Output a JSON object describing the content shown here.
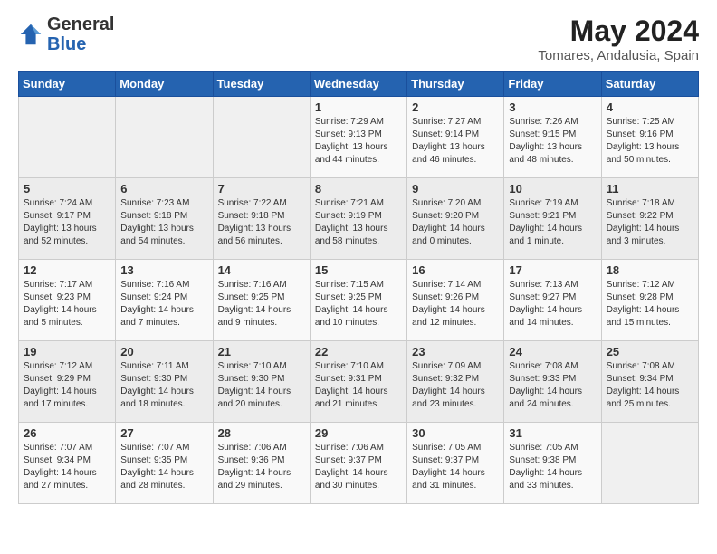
{
  "logo": {
    "general": "General",
    "blue": "Blue"
  },
  "title": "May 2024",
  "subtitle": "Tomares, Andalusia, Spain",
  "days_header": [
    "Sunday",
    "Monday",
    "Tuesday",
    "Wednesday",
    "Thursday",
    "Friday",
    "Saturday"
  ],
  "weeks": [
    [
      {
        "day": "",
        "info": ""
      },
      {
        "day": "",
        "info": ""
      },
      {
        "day": "",
        "info": ""
      },
      {
        "day": "1",
        "info": "Sunrise: 7:29 AM\nSunset: 9:13 PM\nDaylight: 13 hours\nand 44 minutes."
      },
      {
        "day": "2",
        "info": "Sunrise: 7:27 AM\nSunset: 9:14 PM\nDaylight: 13 hours\nand 46 minutes."
      },
      {
        "day": "3",
        "info": "Sunrise: 7:26 AM\nSunset: 9:15 PM\nDaylight: 13 hours\nand 48 minutes."
      },
      {
        "day": "4",
        "info": "Sunrise: 7:25 AM\nSunset: 9:16 PM\nDaylight: 13 hours\nand 50 minutes."
      }
    ],
    [
      {
        "day": "5",
        "info": "Sunrise: 7:24 AM\nSunset: 9:17 PM\nDaylight: 13 hours\nand 52 minutes."
      },
      {
        "day": "6",
        "info": "Sunrise: 7:23 AM\nSunset: 9:18 PM\nDaylight: 13 hours\nand 54 minutes."
      },
      {
        "day": "7",
        "info": "Sunrise: 7:22 AM\nSunset: 9:18 PM\nDaylight: 13 hours\nand 56 minutes."
      },
      {
        "day": "8",
        "info": "Sunrise: 7:21 AM\nSunset: 9:19 PM\nDaylight: 13 hours\nand 58 minutes."
      },
      {
        "day": "9",
        "info": "Sunrise: 7:20 AM\nSunset: 9:20 PM\nDaylight: 14 hours\nand 0 minutes."
      },
      {
        "day": "10",
        "info": "Sunrise: 7:19 AM\nSunset: 9:21 PM\nDaylight: 14 hours\nand 1 minute."
      },
      {
        "day": "11",
        "info": "Sunrise: 7:18 AM\nSunset: 9:22 PM\nDaylight: 14 hours\nand 3 minutes."
      }
    ],
    [
      {
        "day": "12",
        "info": "Sunrise: 7:17 AM\nSunset: 9:23 PM\nDaylight: 14 hours\nand 5 minutes."
      },
      {
        "day": "13",
        "info": "Sunrise: 7:16 AM\nSunset: 9:24 PM\nDaylight: 14 hours\nand 7 minutes."
      },
      {
        "day": "14",
        "info": "Sunrise: 7:16 AM\nSunset: 9:25 PM\nDaylight: 14 hours\nand 9 minutes."
      },
      {
        "day": "15",
        "info": "Sunrise: 7:15 AM\nSunset: 9:25 PM\nDaylight: 14 hours\nand 10 minutes."
      },
      {
        "day": "16",
        "info": "Sunrise: 7:14 AM\nSunset: 9:26 PM\nDaylight: 14 hours\nand 12 minutes."
      },
      {
        "day": "17",
        "info": "Sunrise: 7:13 AM\nSunset: 9:27 PM\nDaylight: 14 hours\nand 14 minutes."
      },
      {
        "day": "18",
        "info": "Sunrise: 7:12 AM\nSunset: 9:28 PM\nDaylight: 14 hours\nand 15 minutes."
      }
    ],
    [
      {
        "day": "19",
        "info": "Sunrise: 7:12 AM\nSunset: 9:29 PM\nDaylight: 14 hours\nand 17 minutes."
      },
      {
        "day": "20",
        "info": "Sunrise: 7:11 AM\nSunset: 9:30 PM\nDaylight: 14 hours\nand 18 minutes."
      },
      {
        "day": "21",
        "info": "Sunrise: 7:10 AM\nSunset: 9:30 PM\nDaylight: 14 hours\nand 20 minutes."
      },
      {
        "day": "22",
        "info": "Sunrise: 7:10 AM\nSunset: 9:31 PM\nDaylight: 14 hours\nand 21 minutes."
      },
      {
        "day": "23",
        "info": "Sunrise: 7:09 AM\nSunset: 9:32 PM\nDaylight: 14 hours\nand 23 minutes."
      },
      {
        "day": "24",
        "info": "Sunrise: 7:08 AM\nSunset: 9:33 PM\nDaylight: 14 hours\nand 24 minutes."
      },
      {
        "day": "25",
        "info": "Sunrise: 7:08 AM\nSunset: 9:34 PM\nDaylight: 14 hours\nand 25 minutes."
      }
    ],
    [
      {
        "day": "26",
        "info": "Sunrise: 7:07 AM\nSunset: 9:34 PM\nDaylight: 14 hours\nand 27 minutes."
      },
      {
        "day": "27",
        "info": "Sunrise: 7:07 AM\nSunset: 9:35 PM\nDaylight: 14 hours\nand 28 minutes."
      },
      {
        "day": "28",
        "info": "Sunrise: 7:06 AM\nSunset: 9:36 PM\nDaylight: 14 hours\nand 29 minutes."
      },
      {
        "day": "29",
        "info": "Sunrise: 7:06 AM\nSunset: 9:37 PM\nDaylight: 14 hours\nand 30 minutes."
      },
      {
        "day": "30",
        "info": "Sunrise: 7:05 AM\nSunset: 9:37 PM\nDaylight: 14 hours\nand 31 minutes."
      },
      {
        "day": "31",
        "info": "Sunrise: 7:05 AM\nSunset: 9:38 PM\nDaylight: 14 hours\nand 33 minutes."
      },
      {
        "day": "",
        "info": ""
      }
    ]
  ]
}
